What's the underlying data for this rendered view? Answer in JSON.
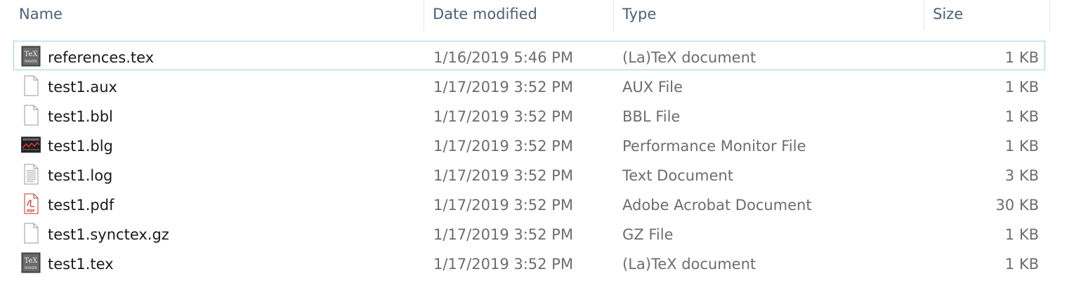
{
  "columns": {
    "name": "Name",
    "date": "Date modified",
    "type": "Type",
    "size": "Size"
  },
  "files": [
    {
      "name": "references.tex",
      "date": "1/16/2019 5:46 PM",
      "type": "(La)TeX document",
      "size": "1 KB",
      "icon": "texmaker-icon",
      "selected": true
    },
    {
      "name": "test1.aux",
      "date": "1/17/2019 3:52 PM",
      "type": "AUX File",
      "size": "1 KB",
      "icon": "blank-file-icon"
    },
    {
      "name": "test1.bbl",
      "date": "1/17/2019 3:52 PM",
      "type": "BBL File",
      "size": "1 KB",
      "icon": "blank-file-icon"
    },
    {
      "name": "test1.blg",
      "date": "1/17/2019 3:52 PM",
      "type": "Performance Monitor File",
      "size": "1 KB",
      "icon": "performance-monitor-icon"
    },
    {
      "name": "test1.log",
      "date": "1/17/2019 3:52 PM",
      "type": "Text Document",
      "size": "3 KB",
      "icon": "text-document-icon"
    },
    {
      "name": "test1.pdf",
      "date": "1/17/2019 3:52 PM",
      "type": "Adobe Acrobat Document",
      "size": "30 KB",
      "icon": "pdf-icon"
    },
    {
      "name": "test1.synctex.gz",
      "date": "1/17/2019 3:52 PM",
      "type": "GZ File",
      "size": "1 KB",
      "icon": "blank-file-icon"
    },
    {
      "name": "test1.tex",
      "date": "1/17/2019 3:52 PM",
      "type": "(La)TeX document",
      "size": "1 KB",
      "icon": "texmaker-icon"
    }
  ],
  "colors": {
    "header_text": "#4c607a",
    "selection_border": "#99d1e6",
    "secondary_text": "#6d6d6d"
  }
}
